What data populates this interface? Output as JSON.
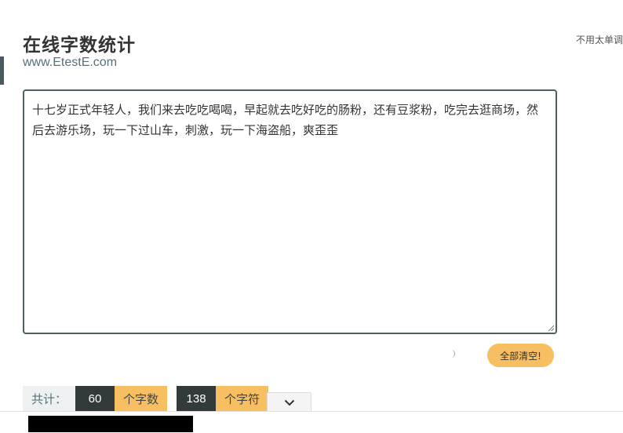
{
  "header": {
    "title": "在线字数统计",
    "subtitle": "www.EtestE.com",
    "side_note": "不用太单调"
  },
  "editor": {
    "text": "十七岁正式年轻人，我们来去吃吃喝喝，早起就去吃好吃的肠粉，还有豆浆粉，吃完去逛商场，然后去游乐场，玩一下过山车，刺激，玩一下海盗船，爽歪歪"
  },
  "actions": {
    "clear_label": "全部清空!"
  },
  "stats": {
    "total_label": "共计：",
    "char_count": "60",
    "char_unit": "个字数",
    "symbol_count": "138",
    "symbol_unit": "个字符"
  },
  "icons": {
    "collapse": "chevron-down-icon",
    "loading": "spinner-icon",
    "resize": "resize-grip-icon"
  },
  "colors": {
    "accent": "#f7be62",
    "dark": "#333a3c",
    "border": "#4d5f63"
  }
}
